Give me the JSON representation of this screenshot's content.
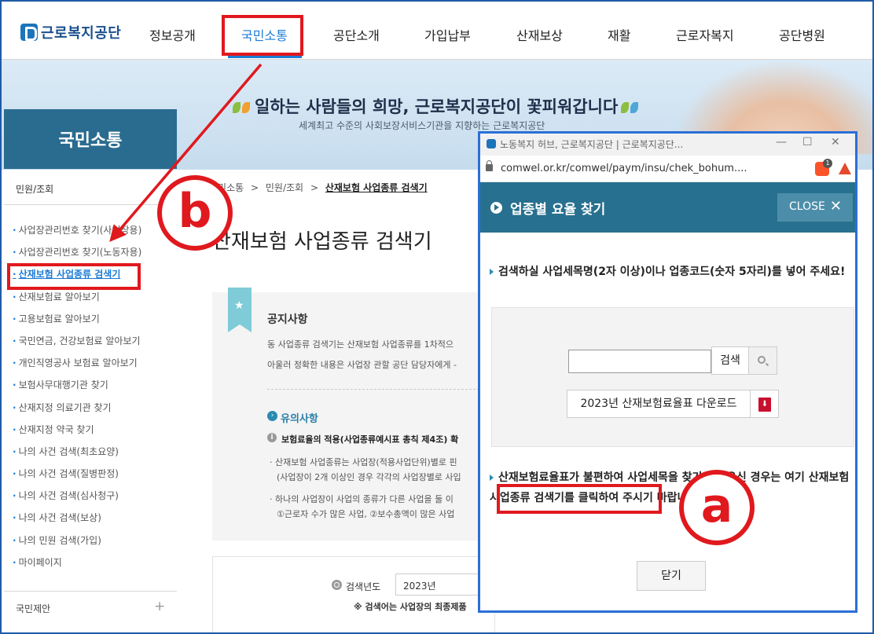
{
  "header": {
    "logo_text": "근로복지공단",
    "nav": [
      "정보공개",
      "국민소통",
      "공단소개",
      "가입납부",
      "산재보상",
      "재활",
      "근로자복지",
      "공단병원"
    ],
    "active_nav": "국민소통"
  },
  "hero": {
    "title": "일하는 사람들의 희망, 근로복지공단이 꽃피워갑니다",
    "subtitle": "세계최고 수준의 사회보장서비스기관을 지향하는 근로복지공단"
  },
  "sidebar": {
    "title": "국민소통",
    "section": "민원/조회",
    "items": [
      "사업장관리번호 찾기(사업장용)",
      "사업장관리번호 찾기(노동자용)",
      "산재보험 사업종류 검색기",
      "산재보험료 알아보기",
      "고용보험료 알아보기",
      "국민연금, 건강보험료 알아보기",
      "개인직영공사 보험료 알아보기",
      "보험사무대행기관 찾기",
      "산재지정 의료기관 찾기",
      "산재지정 약국 찾기",
      "나의 사건 검색(최초요양)",
      "나의 사건 검색(질병판정)",
      "나의 사건 검색(심사청구)",
      "나의 사건 검색(보상)",
      "나의 민원 검색(가입)",
      "마이페이지"
    ],
    "bottom_label": "국민제안",
    "bottom_plus": "+"
  },
  "main": {
    "breadcrumb": [
      "국민소통",
      "민원/조회",
      "산재보험 사업종류 검색기"
    ],
    "breadcrumb_sep": ">",
    "page_title": "산재보험 사업종류 검색기",
    "notice_title": "공지사항",
    "notice_line1": "동 사업종류 검색기는 산재보험 사업종류를 1차적으",
    "notice_line2": "아울러 정확한 내용은 사업장 관할 공단 담당자에게 -",
    "caution_title": "유의사항",
    "info_text": "보험료율의 적용(사업종류예시표 총칙 제4조) 확",
    "para1_line1": "· 산재보험 사업종류는 사업장(적용사업단위)별로 핀",
    "para1_line2": "(사업장이 2개 이상인 경우 각각의 사업장별로 사입",
    "para2_line1": "· 하나의 사업장이 사업의 종류가 다른 사업을 둘 이",
    "para2_line2": "①근로자 수가 많은 사업, ②보수총액이 많은 사업",
    "year_label": "검색년도",
    "year_value": "2023년",
    "year_note": "※ 검색어는 사업장의 최종제품"
  },
  "popup": {
    "window_title": "노동복지 허브, 근로복지공단 | 근로복지공단...",
    "url": "comwel.or.kr/comwel/paym/insu/chek_bohum....",
    "brave_badge": "1",
    "header_title": "업종별 요율 찾기",
    "close_label": "CLOSE",
    "instruction1": "검색하실 사업세목명(2자 이상)이나 업종코드(숫자 5자리)를 넣어 주세요!",
    "search_button": "검색",
    "input_value": "",
    "download_button": "2023년 산재보험료율표 다운로드",
    "instruction2": "산재보험료율표가 불편하여 사업세목을 찾기 어려우신 경우는 여기 산재보험 사업종류 검색기를 클릭하여 주시기 바랍니다",
    "close_button": "닫기"
  },
  "annotations": {
    "label_a": "ⓐ",
    "label_b": "ⓑ",
    "color": "#e0191e"
  }
}
